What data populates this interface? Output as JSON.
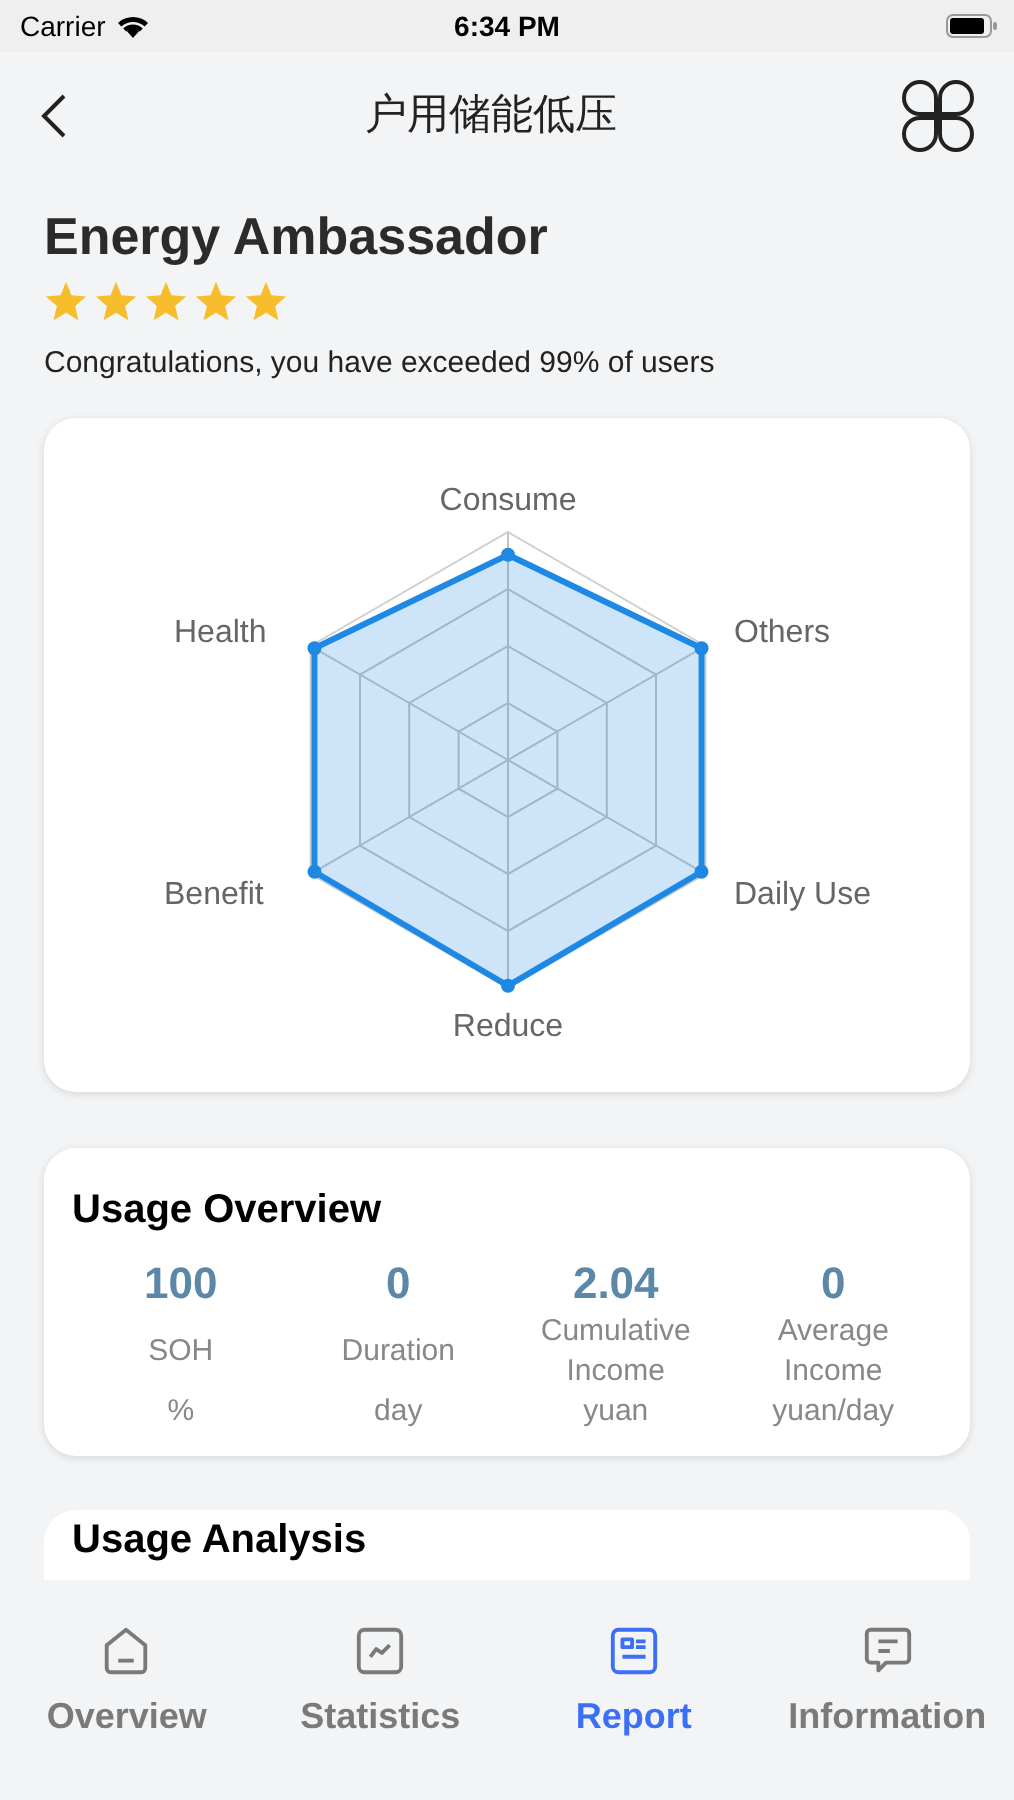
{
  "status_bar": {
    "carrier": "Carrier",
    "time": "6:34 PM"
  },
  "nav": {
    "title": "户用储能低压"
  },
  "badge": {
    "title": "Energy Ambassador",
    "stars": 5,
    "message": "Congratulations, you have exceeded 99% of users"
  },
  "radar": {
    "axes": [
      "Consume",
      "Others",
      "Daily Use",
      "Reduce",
      "Benefit",
      "Health"
    ]
  },
  "usage_overview": {
    "title": "Usage Overview",
    "metrics": [
      {
        "value": "100",
        "label": "SOH",
        "unit": "%"
      },
      {
        "value": "0",
        "label": "Duration",
        "unit": "day"
      },
      {
        "value": "2.04",
        "label": "Cumulative Income",
        "unit": "yuan"
      },
      {
        "value": "0",
        "label": "Average Income",
        "unit": "yuan/day"
      }
    ]
  },
  "usage_analysis": {
    "title": "Usage Analysis"
  },
  "tabs": [
    {
      "label": "Overview",
      "kind": "home",
      "selected": false
    },
    {
      "label": "Statistics",
      "kind": "chart",
      "selected": false
    },
    {
      "label": "Report",
      "kind": "report",
      "selected": true
    },
    {
      "label": "Information",
      "kind": "message",
      "selected": false
    }
  ]
}
